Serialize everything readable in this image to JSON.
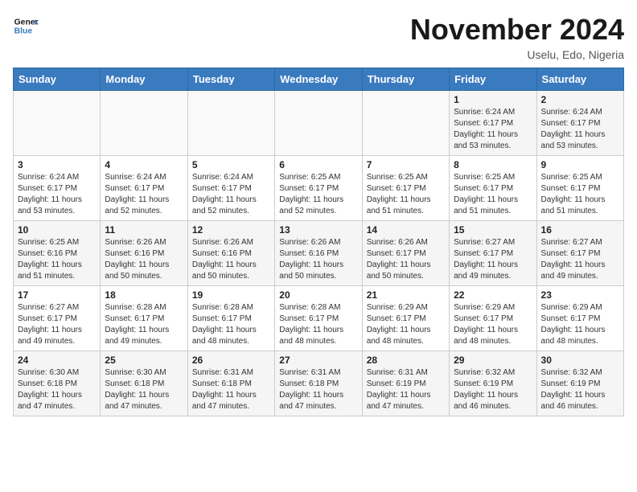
{
  "header": {
    "logo_line1": "General",
    "logo_line2": "Blue",
    "month": "November 2024",
    "location": "Uselu, Edo, Nigeria"
  },
  "weekdays": [
    "Sunday",
    "Monday",
    "Tuesday",
    "Wednesday",
    "Thursday",
    "Friday",
    "Saturday"
  ],
  "weeks": [
    [
      {
        "day": "",
        "info": ""
      },
      {
        "day": "",
        "info": ""
      },
      {
        "day": "",
        "info": ""
      },
      {
        "day": "",
        "info": ""
      },
      {
        "day": "",
        "info": ""
      },
      {
        "day": "1",
        "info": "Sunrise: 6:24 AM\nSunset: 6:17 PM\nDaylight: 11 hours\nand 53 minutes."
      },
      {
        "day": "2",
        "info": "Sunrise: 6:24 AM\nSunset: 6:17 PM\nDaylight: 11 hours\nand 53 minutes."
      }
    ],
    [
      {
        "day": "3",
        "info": "Sunrise: 6:24 AM\nSunset: 6:17 PM\nDaylight: 11 hours\nand 53 minutes."
      },
      {
        "day": "4",
        "info": "Sunrise: 6:24 AM\nSunset: 6:17 PM\nDaylight: 11 hours\nand 52 minutes."
      },
      {
        "day": "5",
        "info": "Sunrise: 6:24 AM\nSunset: 6:17 PM\nDaylight: 11 hours\nand 52 minutes."
      },
      {
        "day": "6",
        "info": "Sunrise: 6:25 AM\nSunset: 6:17 PM\nDaylight: 11 hours\nand 52 minutes."
      },
      {
        "day": "7",
        "info": "Sunrise: 6:25 AM\nSunset: 6:17 PM\nDaylight: 11 hours\nand 51 minutes."
      },
      {
        "day": "8",
        "info": "Sunrise: 6:25 AM\nSunset: 6:17 PM\nDaylight: 11 hours\nand 51 minutes."
      },
      {
        "day": "9",
        "info": "Sunrise: 6:25 AM\nSunset: 6:17 PM\nDaylight: 11 hours\nand 51 minutes."
      }
    ],
    [
      {
        "day": "10",
        "info": "Sunrise: 6:25 AM\nSunset: 6:16 PM\nDaylight: 11 hours\nand 51 minutes."
      },
      {
        "day": "11",
        "info": "Sunrise: 6:26 AM\nSunset: 6:16 PM\nDaylight: 11 hours\nand 50 minutes."
      },
      {
        "day": "12",
        "info": "Sunrise: 6:26 AM\nSunset: 6:16 PM\nDaylight: 11 hours\nand 50 minutes."
      },
      {
        "day": "13",
        "info": "Sunrise: 6:26 AM\nSunset: 6:16 PM\nDaylight: 11 hours\nand 50 minutes."
      },
      {
        "day": "14",
        "info": "Sunrise: 6:26 AM\nSunset: 6:17 PM\nDaylight: 11 hours\nand 50 minutes."
      },
      {
        "day": "15",
        "info": "Sunrise: 6:27 AM\nSunset: 6:17 PM\nDaylight: 11 hours\nand 49 minutes."
      },
      {
        "day": "16",
        "info": "Sunrise: 6:27 AM\nSunset: 6:17 PM\nDaylight: 11 hours\nand 49 minutes."
      }
    ],
    [
      {
        "day": "17",
        "info": "Sunrise: 6:27 AM\nSunset: 6:17 PM\nDaylight: 11 hours\nand 49 minutes."
      },
      {
        "day": "18",
        "info": "Sunrise: 6:28 AM\nSunset: 6:17 PM\nDaylight: 11 hours\nand 49 minutes."
      },
      {
        "day": "19",
        "info": "Sunrise: 6:28 AM\nSunset: 6:17 PM\nDaylight: 11 hours\nand 48 minutes."
      },
      {
        "day": "20",
        "info": "Sunrise: 6:28 AM\nSunset: 6:17 PM\nDaylight: 11 hours\nand 48 minutes."
      },
      {
        "day": "21",
        "info": "Sunrise: 6:29 AM\nSunset: 6:17 PM\nDaylight: 11 hours\nand 48 minutes."
      },
      {
        "day": "22",
        "info": "Sunrise: 6:29 AM\nSunset: 6:17 PM\nDaylight: 11 hours\nand 48 minutes."
      },
      {
        "day": "23",
        "info": "Sunrise: 6:29 AM\nSunset: 6:17 PM\nDaylight: 11 hours\nand 48 minutes."
      }
    ],
    [
      {
        "day": "24",
        "info": "Sunrise: 6:30 AM\nSunset: 6:18 PM\nDaylight: 11 hours\nand 47 minutes."
      },
      {
        "day": "25",
        "info": "Sunrise: 6:30 AM\nSunset: 6:18 PM\nDaylight: 11 hours\nand 47 minutes."
      },
      {
        "day": "26",
        "info": "Sunrise: 6:31 AM\nSunset: 6:18 PM\nDaylight: 11 hours\nand 47 minutes."
      },
      {
        "day": "27",
        "info": "Sunrise: 6:31 AM\nSunset: 6:18 PM\nDaylight: 11 hours\nand 47 minutes."
      },
      {
        "day": "28",
        "info": "Sunrise: 6:31 AM\nSunset: 6:19 PM\nDaylight: 11 hours\nand 47 minutes."
      },
      {
        "day": "29",
        "info": "Sunrise: 6:32 AM\nSunset: 6:19 PM\nDaylight: 11 hours\nand 46 minutes."
      },
      {
        "day": "30",
        "info": "Sunrise: 6:32 AM\nSunset: 6:19 PM\nDaylight: 11 hours\nand 46 minutes."
      }
    ]
  ]
}
